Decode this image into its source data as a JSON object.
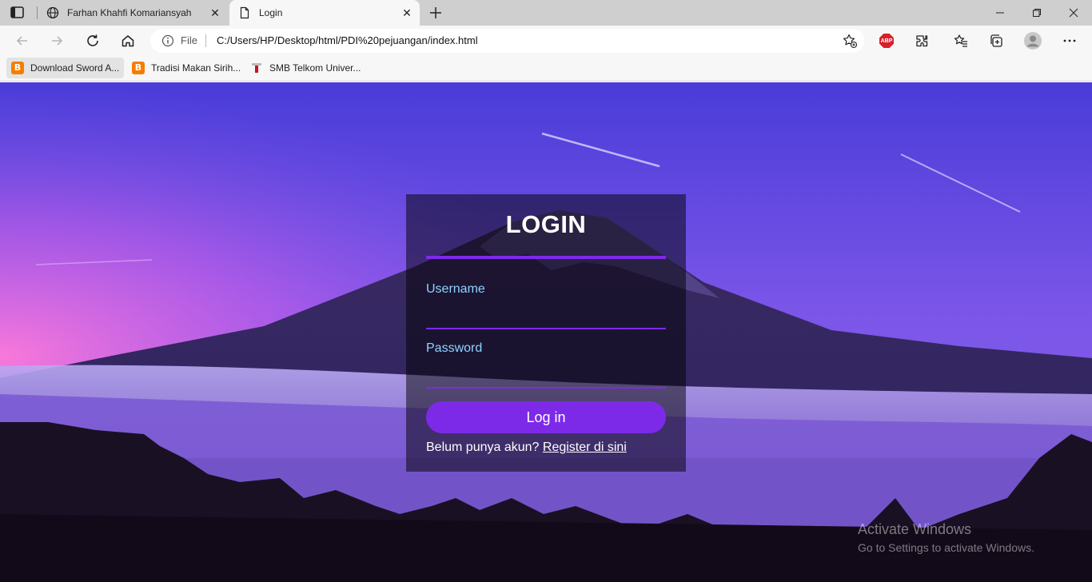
{
  "browser": {
    "tabs": [
      {
        "title": "Farhan Khahfi Komariansyah",
        "active": false
      },
      {
        "title": "Login",
        "active": true
      }
    ],
    "address": {
      "scheme_label": "File",
      "url": "C:/Users/HP/Desktop/html/PDI%20pejuangan/index.html"
    },
    "extension_badge": "ABP",
    "bookmarks": [
      {
        "label": "Download Sword A..."
      },
      {
        "label": "Tradisi Makan Sirih..."
      },
      {
        "label": "SMB Telkom Univer..."
      }
    ]
  },
  "login": {
    "title": "LOGIN",
    "username_label": "Username",
    "username_value": "",
    "password_label": "Password",
    "password_value": "",
    "submit_label": "Log in",
    "register_prompt": "Belum punya akun?",
    "register_link": "Register di sini"
  },
  "watermark": {
    "line1": "Activate Windows",
    "line2": "Go to Settings to activate Windows."
  },
  "colors": {
    "accent": "#7d2ae8",
    "label": "#8fd3ff",
    "sky_top": "#4a3cd8",
    "sky_pink": "#e066e0"
  }
}
